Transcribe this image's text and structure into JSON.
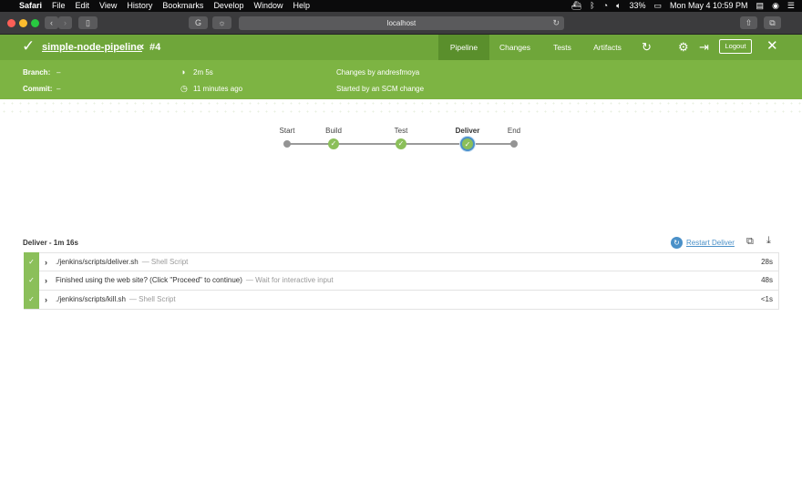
{
  "menubar": {
    "apple": "",
    "items": [
      "Safari",
      "File",
      "Edit",
      "View",
      "History",
      "Bookmarks",
      "Develop",
      "Window",
      "Help"
    ],
    "battery": "33%",
    "clock": "Mon May 4  10:59 PM"
  },
  "browser": {
    "url": "localhost",
    "back": "‹",
    "forward": "›"
  },
  "header": {
    "pipeline_name": "simple-node-pipeline",
    "run_number": "#4",
    "tabs": [
      "Pipeline",
      "Changes",
      "Tests",
      "Artifacts"
    ],
    "logout_label": "Logout"
  },
  "info": {
    "branch_label": "Branch:",
    "branch_value": "–",
    "commit_label": "Commit:",
    "commit_value": "–",
    "duration": "2m 5s",
    "started_ago": "11 minutes ago",
    "changes_by": "Changes by andresfmoya",
    "started_by": "Started by an SCM change"
  },
  "graph": {
    "stages": [
      "Start",
      "Build",
      "Test",
      "Deliver",
      "End"
    ],
    "selected": "Deliver"
  },
  "stage_detail": {
    "title": "Deliver - 1m 16s",
    "restart_label": "Restart Deliver",
    "steps": [
      {
        "name": "./jenkins/scripts/deliver.sh",
        "type": "— Shell Script",
        "duration": "28s"
      },
      {
        "name": "Finished using the web site? (Click \"Proceed\" to continue)",
        "type": "— Wait for interactive input",
        "duration": "48s"
      },
      {
        "name": "./jenkins/scripts/kill.sh",
        "type": "— Shell Script",
        "duration": "<1s"
      }
    ]
  },
  "colors": {
    "header_green": "#6fa63a",
    "info_green": "#7db443",
    "success_green": "#8bbf5a",
    "link_blue": "#4a90c8"
  }
}
